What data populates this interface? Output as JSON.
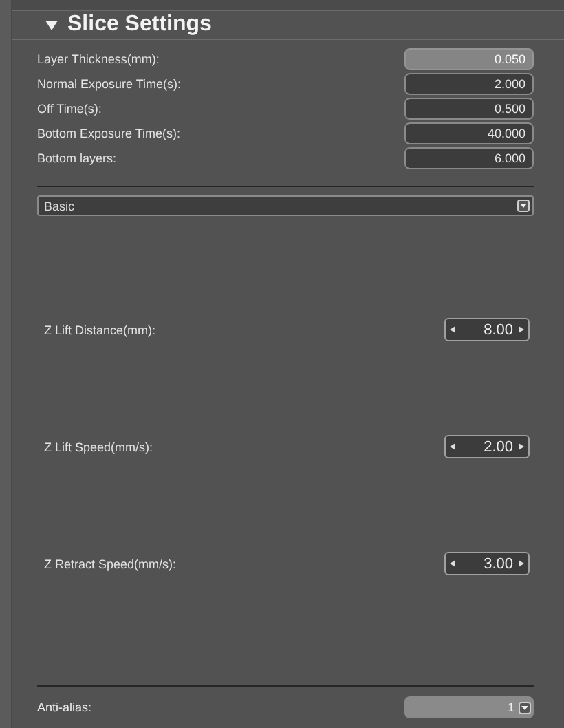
{
  "panel": {
    "title": "Slice Settings",
    "expanded": true
  },
  "fields": [
    {
      "label": "Layer Thickness(mm):",
      "value": "0.050",
      "disabled": true
    },
    {
      "label": "Normal Exposure Time(s):",
      "value": "2.000",
      "disabled": false
    },
    {
      "label": "Off Time(s):",
      "value": "0.500",
      "disabled": false
    },
    {
      "label": "Bottom Exposure Time(s):",
      "value": "40.000",
      "disabled": false
    },
    {
      "label": "Bottom layers:",
      "value": "6.000",
      "disabled": false
    }
  ],
  "mode_dropdown": {
    "value": "Basic"
  },
  "spinners": [
    {
      "label": "Z Lift Distance(mm):",
      "value": "8.00"
    },
    {
      "label": "Z Lift Speed(mm/s):",
      "value": "2.00"
    },
    {
      "label": "Z Retract Speed(mm/s):",
      "value": "3.00"
    }
  ],
  "anti_alias": {
    "label": "Anti-alias:",
    "value": "1",
    "disabled": true
  }
}
